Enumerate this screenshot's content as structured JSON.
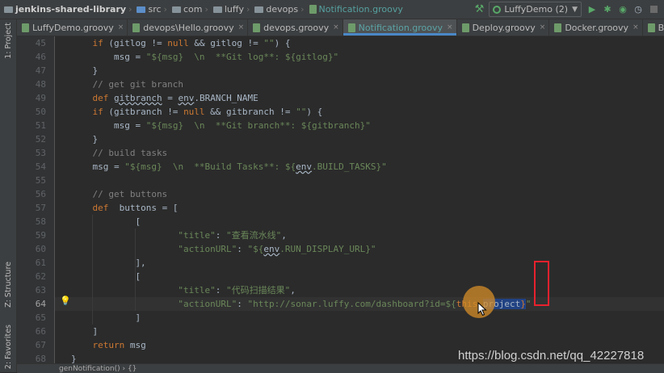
{
  "breadcrumbs": [
    {
      "label": "jenkins-shared-library",
      "icon": "folder-icon"
    },
    {
      "label": "src",
      "icon": "source-folder-icon"
    },
    {
      "label": "com",
      "icon": "folder-icon"
    },
    {
      "label": "luffy",
      "icon": "folder-icon"
    },
    {
      "label": "devops",
      "icon": "folder-icon"
    },
    {
      "label": "Notification.groovy",
      "icon": "groovy-file-icon"
    }
  ],
  "toolbar": {
    "run_config": "LuffyDemo (2)",
    "buttons": [
      "build-hammer-icon",
      "run-icon",
      "debug-icon",
      "coverage-icon",
      "profile-icon",
      "stop-icon"
    ]
  },
  "left_stripe": {
    "project": "1: Project",
    "structure": "Z: Structure",
    "favorites": "2: Favorites"
  },
  "tabs": [
    {
      "label": "LuffyDemo.groovy",
      "active": false
    },
    {
      "label": "devops\\Hello.groovy",
      "active": false
    },
    {
      "label": "devops.groovy",
      "active": false
    },
    {
      "label": "Notification.groovy",
      "active": true
    },
    {
      "label": "Deploy.groovy",
      "active": false
    },
    {
      "label": "Docker.groovy",
      "active": false
    },
    {
      "label": "BuildMessage.groovy",
      "active": false
    }
  ],
  "editor": {
    "current_line": 64,
    "lines": [
      {
        "num": "45",
        "indent": 4,
        "tokens": [
          {
            "t": "if",
            "c": "kw"
          },
          {
            "t": " (gitlog != "
          },
          {
            "t": "null",
            "c": "kw"
          },
          {
            "t": " && gitlog != "
          },
          {
            "t": "\"\"",
            "c": "str"
          },
          {
            "t": ") {"
          }
        ]
      },
      {
        "num": "46",
        "indent": 8,
        "tokens": [
          {
            "t": "msg = "
          },
          {
            "t": "\"${msg}  \\n  **Git log**: ${gitlog}\"",
            "c": "str"
          }
        ]
      },
      {
        "num": "47",
        "indent": 4,
        "tokens": [
          {
            "t": "}"
          }
        ]
      },
      {
        "num": "48",
        "indent": 4,
        "tokens": [
          {
            "t": "// get git branch",
            "c": "cmt"
          }
        ]
      },
      {
        "num": "49",
        "indent": 4,
        "tokens": [
          {
            "t": "def ",
            "c": "kw"
          },
          {
            "t": "gitbranch",
            "c": "env"
          },
          {
            "t": " = "
          },
          {
            "t": "env",
            "c": "env"
          },
          {
            "t": ".BRANCH_NAME"
          }
        ]
      },
      {
        "num": "50",
        "indent": 4,
        "tokens": [
          {
            "t": "if",
            "c": "kw"
          },
          {
            "t": " (gitbranch != "
          },
          {
            "t": "null",
            "c": "kw"
          },
          {
            "t": " && gitbranch != "
          },
          {
            "t": "\"\"",
            "c": "str"
          },
          {
            "t": ") {"
          }
        ]
      },
      {
        "num": "51",
        "indent": 8,
        "tokens": [
          {
            "t": "msg = "
          },
          {
            "t": "\"${msg}  \\n  **Git branch**: ${gitbranch}\"",
            "c": "str"
          }
        ]
      },
      {
        "num": "52",
        "indent": 4,
        "tokens": [
          {
            "t": "}"
          }
        ]
      },
      {
        "num": "53",
        "indent": 4,
        "tokens": [
          {
            "t": "// build tasks",
            "c": "cmt"
          }
        ]
      },
      {
        "num": "54",
        "indent": 4,
        "tokens": [
          {
            "t": "msg = "
          },
          {
            "t": "\"${msg}  \\n  **Build Tasks**: ${",
            "c": "str"
          },
          {
            "t": "env",
            "c": "env"
          },
          {
            "t": ".BUILD_TASKS}\"",
            "c": "str"
          }
        ]
      },
      {
        "num": "55",
        "indent": 0,
        "tokens": []
      },
      {
        "num": "56",
        "indent": 4,
        "tokens": [
          {
            "t": "// get buttons",
            "c": "cmt"
          }
        ]
      },
      {
        "num": "57",
        "indent": 4,
        "tokens": [
          {
            "t": "def ",
            "c": "kw"
          },
          {
            "t": " buttons = ["
          }
        ]
      },
      {
        "num": "58",
        "indent": 12,
        "tokens": [
          {
            "t": "["
          }
        ]
      },
      {
        "num": "59",
        "indent": 20,
        "tokens": [
          {
            "t": "\"title\"",
            "c": "str"
          },
          {
            "t": ": "
          },
          {
            "t": "\"查看流水线\"",
            "c": "str"
          },
          {
            "t": ","
          }
        ]
      },
      {
        "num": "60",
        "indent": 20,
        "tokens": [
          {
            "t": "\"actionURL\"",
            "c": "str"
          },
          {
            "t": ": "
          },
          {
            "t": "\"${",
            "c": "str"
          },
          {
            "t": "env",
            "c": "env"
          },
          {
            "t": ".RUN_DISPLAY_URL}\"",
            "c": "str"
          }
        ]
      },
      {
        "num": "61",
        "indent": 12,
        "tokens": [
          {
            "t": "],"
          }
        ]
      },
      {
        "num": "62",
        "indent": 12,
        "tokens": [
          {
            "t": "["
          }
        ]
      },
      {
        "num": "63",
        "indent": 20,
        "tokens": [
          {
            "t": "\"title\"",
            "c": "str"
          },
          {
            "t": ": "
          },
          {
            "t": "\"代码扫描结果\"",
            "c": "str"
          },
          {
            "t": ","
          }
        ]
      },
      {
        "num": "64",
        "indent": 20,
        "tokens": [
          {
            "t": "\"actionURL\"",
            "c": "str"
          },
          {
            "t": ": "
          },
          {
            "t": "\"http://sonar.luffy.com/dashboard?id=${",
            "c": "str"
          },
          {
            "t": "this",
            "c": "kw"
          },
          {
            "t": "."
          },
          {
            "t": "project",
            "c": "selv"
          },
          {
            "t": "}",
            "c": "sel"
          },
          {
            "t": "\"",
            "c": "str"
          }
        ]
      },
      {
        "num": "65",
        "indent": 12,
        "tokens": [
          {
            "t": "]"
          }
        ]
      },
      {
        "num": "66",
        "indent": 4,
        "tokens": [
          {
            "t": "]"
          }
        ]
      },
      {
        "num": "67",
        "indent": 4,
        "tokens": [
          {
            "t": "return ",
            "c": "kw"
          },
          {
            "t": "msg"
          }
        ]
      },
      {
        "num": "68",
        "indent": 0,
        "tokens": [
          {
            "t": "}"
          }
        ]
      }
    ]
  },
  "watermark": "https://blog.csdn.net/qq_42227818",
  "bottom_breadcrumb": "genNotification()  ›  {}",
  "colors": {
    "background": "#2b2b2b",
    "keyword": "#cc7832",
    "string": "#6a8759",
    "comment": "#808080",
    "text": "#a9b7c6",
    "selection": "#214283",
    "annotation_box": "#e8212d",
    "cursor_halo": "#d68e28",
    "active_tab_underline": "#4a88c7"
  }
}
